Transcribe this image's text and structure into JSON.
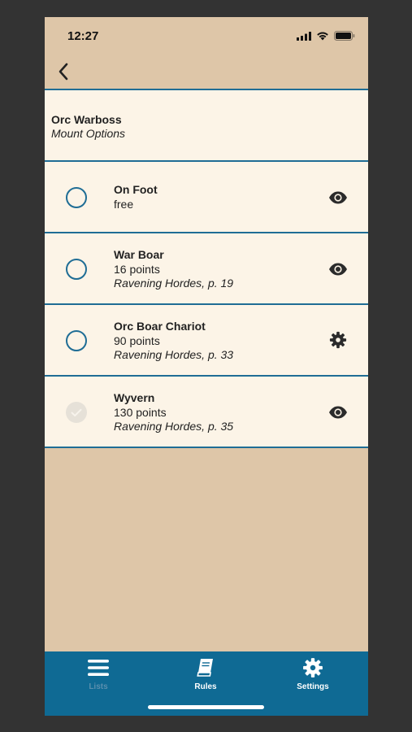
{
  "status_bar": {
    "time": "12:27",
    "icons": [
      "signal-icon",
      "wifi-icon",
      "battery-icon"
    ]
  },
  "nav": {
    "back_icon": "chevron-left-icon"
  },
  "header": {
    "title": "Orc Warboss",
    "subtitle": "Mount Options"
  },
  "options": [
    {
      "name": "On Foot",
      "cost": "free",
      "source": "",
      "selected": false,
      "action_icon": "eye-icon"
    },
    {
      "name": "War Boar",
      "cost": "16 points",
      "source": "Ravening Hordes, p. 19",
      "selected": false,
      "action_icon": "eye-icon"
    },
    {
      "name": "Orc Boar Chariot",
      "cost": "90 points",
      "source": "Ravening Hordes, p. 33",
      "selected": false,
      "action_icon": "gear-icon"
    },
    {
      "name": "Wyvern",
      "cost": "130 points",
      "source": "Ravening Hordes, p. 35",
      "selected": true,
      "action_icon": "eye-icon"
    }
  ],
  "tabs": [
    {
      "label": "Lists",
      "icon": "list-icon",
      "active": false
    },
    {
      "label": "Rules",
      "icon": "book-icon",
      "active": true
    },
    {
      "label": "Settings",
      "icon": "gear-icon",
      "active": true
    }
  ],
  "colors": {
    "background": "#dec6a8",
    "card": "#fcf4e7",
    "accent": "#1f6d95",
    "tab_bar": "#0f6a94"
  }
}
